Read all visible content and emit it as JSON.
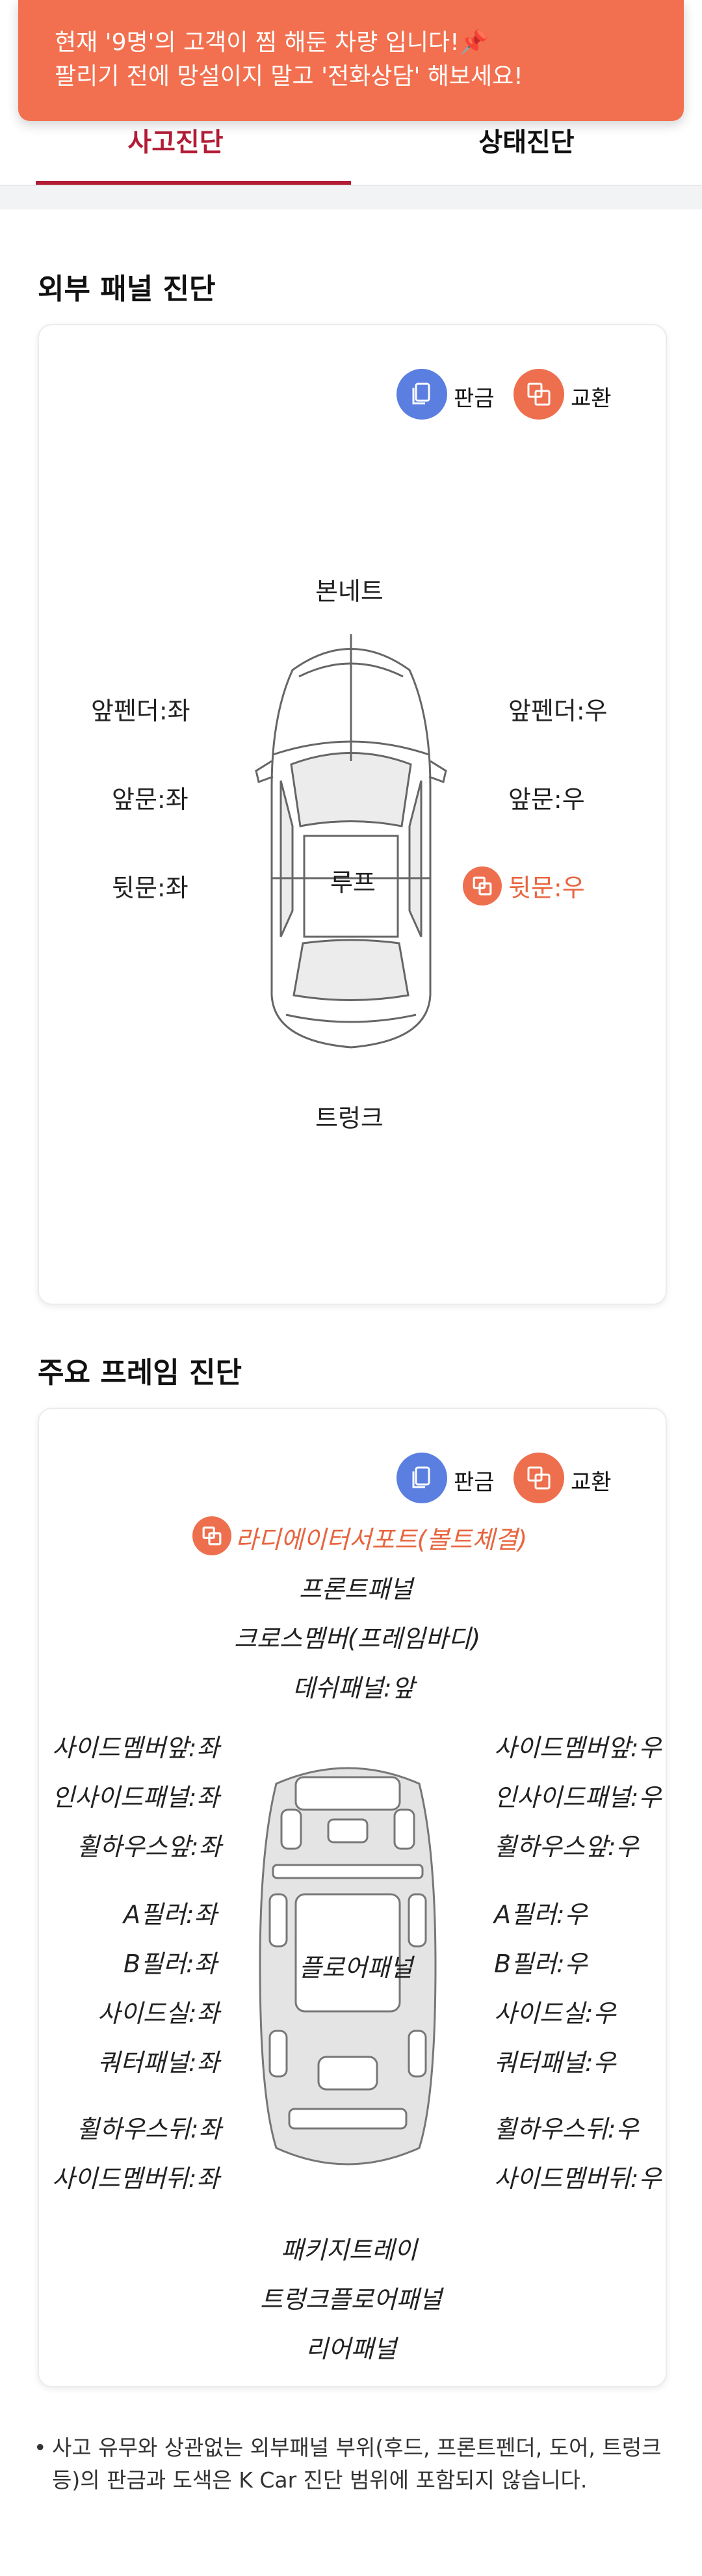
{
  "toast": {
    "line1": "현재 '9명'의 고객이 찜 해둔 차량 입니다!📌",
    "line2": "팔리기 전에 망설이지 말고 '전화상담' 해보세요!"
  },
  "tabs": [
    {
      "label": "사고진단",
      "active": true
    },
    {
      "label": "상태진단",
      "active": false
    }
  ],
  "colors": {
    "accent": "#B21D36",
    "panel_repair": "#5A7FE0",
    "exchange": "#EE6F4E",
    "toast": "#F2704F"
  },
  "legend": {
    "repair": "판금",
    "exchange": "교환",
    "repair_icon": "panel-repair-icon",
    "exchange_icon": "exchange-icon"
  },
  "exterior": {
    "title": "외부 패널 진단",
    "labels": {
      "bonnet": "본네트",
      "front_fender_left": "앞펜더:좌",
      "front_fender_right": "앞펜더:우",
      "front_door_left": "앞문:좌",
      "front_door_right": "앞문:우",
      "rear_door_left": "뒷문:좌",
      "rear_door_right": "뒷문:우",
      "roof": "루프",
      "trunk": "트렁크"
    },
    "exchanged": [
      "rear_door_right"
    ]
  },
  "frame": {
    "title": "주요 프레임 진단",
    "labels": {
      "radiator_support": "라디에이터서포트(볼트체결)",
      "front_panel": "프론트패널",
      "cross_member": "크로스멤버(프레임바디)",
      "dash_panel": "데쉬패널:앞",
      "side_member_front_left": "사이드멤버앞:좌",
      "side_member_front_right": "사이드멤버앞:우",
      "inside_panel_left": "인사이드패널:좌",
      "inside_panel_right": "인사이드패널:우",
      "wheelhouse_front_left": "휠하우스앞:좌",
      "wheelhouse_front_right": "휠하우스앞:우",
      "a_pillar_left": "A필러:좌",
      "a_pillar_right": "A필러:우",
      "b_pillar_left": "B필러:좌",
      "b_pillar_right": "B필러:우",
      "side_sill_left": "사이드실:좌",
      "side_sill_right": "사이드실:우",
      "quarter_panel_left": "쿼터패널:좌",
      "quarter_panel_right": "쿼터패널:우",
      "floor_panel": "플로어패널",
      "wheelhouse_rear_left": "휠하우스뒤:좌",
      "wheelhouse_rear_right": "휠하우스뒤:우",
      "side_member_rear_left": "사이드멤버뒤:좌",
      "side_member_rear_right": "사이드멤버뒤:우",
      "package_tray": "패키지트레이",
      "trunk_floor_panel": "트렁크플로어패널",
      "rear_panel": "리어패널"
    },
    "exchanged": [
      "radiator_support"
    ]
  },
  "footnote": {
    "bullet": "•",
    "text": "사고 유무와 상관없는 외부패널 부위(후드, 프론트펜더, 도어, 트렁크 등)의 판금과 도색은 K Car 진단 범위에 포함되지 않습니다."
  }
}
